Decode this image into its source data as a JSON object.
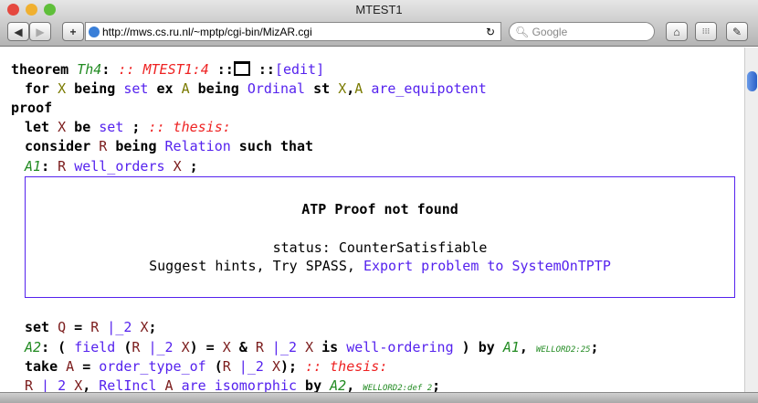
{
  "window": {
    "title": "MTEST1"
  },
  "toolbar": {
    "url": "http://mws.cs.ru.nl/~mptp/cgi-bin/MizAR.cgi",
    "search_placeholder": "Google",
    "add": "+",
    "reload": "↻",
    "back": "◀",
    "forward": "▶",
    "home": "⌂",
    "grid": "⁝⁝⁝",
    "edit": "✎"
  },
  "code": {
    "theorem_kw": "theorem",
    "th_label": "Th4",
    "th_comment": ":: MTEST1:4",
    "sep1": "::",
    "sep2": "::",
    "edit_link": "[edit]",
    "l2": [
      "for ",
      "X",
      " being ",
      "set",
      " ex ",
      "A",
      " being ",
      "Ordinal",
      " st ",
      "X",
      ",",
      "A",
      " ",
      "are_equipotent"
    ],
    "proof": "proof",
    "l4": [
      "let ",
      "X",
      " be ",
      "set",
      " ; ",
      ":: thesis:"
    ],
    "l5": [
      "consider ",
      "R",
      " being ",
      "Relation",
      " such that"
    ],
    "l6": [
      "A1",
      ": ",
      "R",
      " ",
      "well_orders",
      " ",
      "X",
      " ;"
    ],
    "atp": {
      "title": "ATP Proof not found",
      "status": "status: CounterSatisfiable",
      "hints": "Suggest hints, Try SPASS, ",
      "export": "Export problem to SystemOnTPTP"
    },
    "l7": [
      "set ",
      "Q",
      " = ",
      "R",
      " |_2 ",
      "X",
      ";"
    ],
    "l8": [
      "A2",
      ": ( ",
      "field",
      " (",
      "R",
      " |_2 ",
      "X",
      ") = ",
      "X",
      " & ",
      "R",
      " |_2 ",
      "X",
      " is ",
      "well-ordering",
      " ) ",
      "by ",
      "A1",
      ", ",
      "WELLORD2:25",
      ";"
    ],
    "l9": [
      "take ",
      "A",
      " = ",
      "order_type_of",
      " (",
      "R",
      " |_2 ",
      "X",
      "); ",
      ":: thesis:"
    ],
    "l10": [
      "R",
      " |_2 ",
      "X",
      ", ",
      "RelIncl",
      " ",
      "A",
      " ",
      "are_isomorphic",
      " by ",
      "A2",
      ", ",
      "WELLORD2:def 2",
      ";"
    ]
  }
}
